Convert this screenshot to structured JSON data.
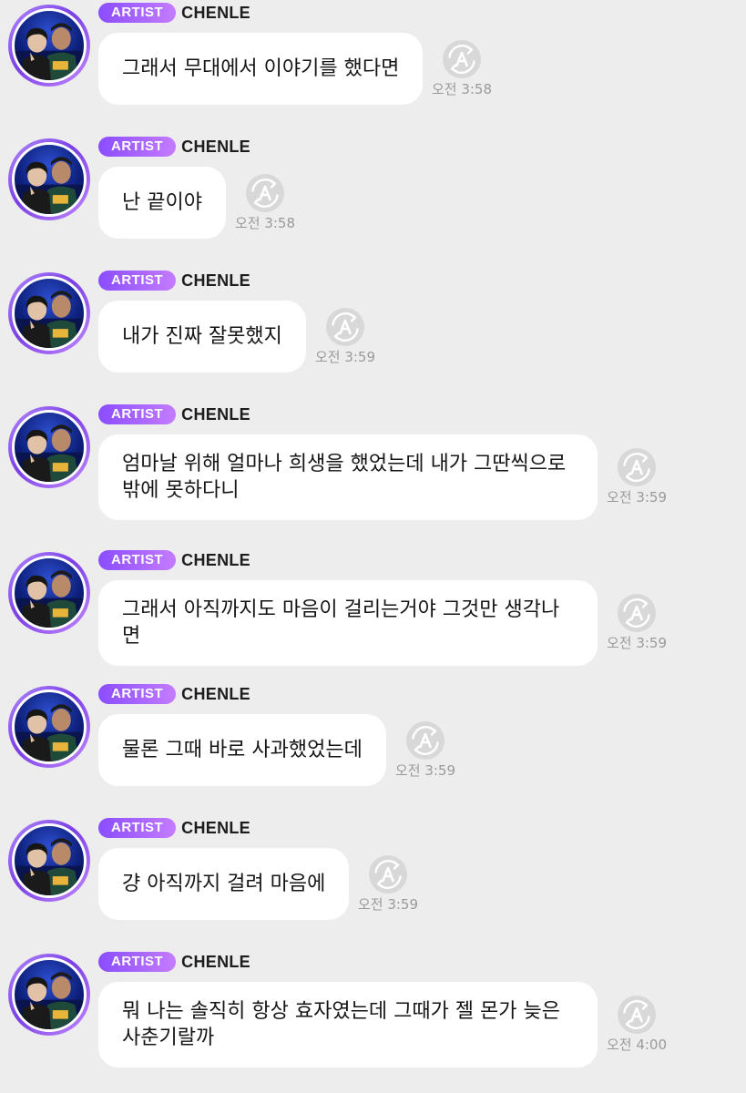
{
  "colors": {
    "background": "#ededed",
    "bubble": "#ffffff",
    "badge_start": "#8a4dff",
    "badge_end": "#c47cff",
    "timestamp": "#9a9a9a"
  },
  "icons": {
    "avatar": "avatar-photo",
    "translate": "translate-icon"
  },
  "messages": [
    {
      "badge": "ARTIST",
      "sender": "CHENLE",
      "text": "그래서 무대에서 이야기를 했다면",
      "time": "오전 3:58"
    },
    {
      "badge": "ARTIST",
      "sender": "CHENLE",
      "text": "난 끝이야",
      "time": "오전 3:58"
    },
    {
      "badge": "ARTIST",
      "sender": "CHENLE",
      "text": "내가 진짜 잘못했지",
      "time": "오전 3:59"
    },
    {
      "badge": "ARTIST",
      "sender": "CHENLE",
      "text": "엄마날 위해 얼마나 희생을 했었는데 내가 그딴씩으로 밖에 못하다니",
      "time": "오전 3:59"
    },
    {
      "badge": "ARTIST",
      "sender": "CHENLE",
      "text": "그래서 아직까지도 마음이 걸리는거야 그것만 생각나면",
      "time": "오전 3:59"
    },
    {
      "badge": "ARTIST",
      "sender": "CHENLE",
      "text": "물론 그때 바로 사과했었는데",
      "time": "오전 3:59"
    },
    {
      "badge": "ARTIST",
      "sender": "CHENLE",
      "text": "걍 아직까지 걸려 마음에",
      "time": "오전 3:59"
    },
    {
      "badge": "ARTIST",
      "sender": "CHENLE",
      "text": "뭐 나는 솔직히 항상 효자였는데 그때가 젤 몬가 늦은 사춘기랄까",
      "time": "오전 4:00"
    }
  ]
}
